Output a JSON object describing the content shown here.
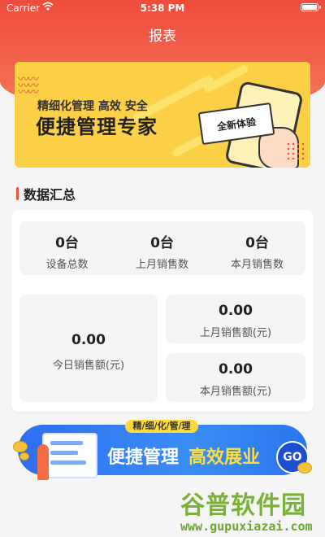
{
  "status_bar": {
    "carrier": "Carrier",
    "time": "5:38 PM",
    "wifi_icon": "wifi-icon",
    "battery_icon": "battery-icon"
  },
  "header": {
    "title": "报表"
  },
  "top_banner": {
    "subtitle": "精细化管理 高效 安全",
    "headline": "便捷管理专家",
    "card_text": "全新体验"
  },
  "section": {
    "title": "数据汇总"
  },
  "summary": {
    "top_stats": [
      {
        "value": "0台",
        "label": "设备总数"
      },
      {
        "value": "0台",
        "label": "上月销售数"
      },
      {
        "value": "0台",
        "label": "本月销售数"
      }
    ],
    "today_sales": {
      "value": "0.00",
      "label": "今日销售额(元)"
    },
    "last_month_sales": {
      "value": "0.00",
      "label": "上月销售额(元)"
    },
    "this_month_sales": {
      "value": "0.00",
      "label": "本月销售额(元)"
    }
  },
  "bottom_banner": {
    "tag": "精/细/化/管/理",
    "text_white": "便捷管理",
    "text_yellow": "高效展业",
    "go": "GO"
  },
  "watermark": {
    "main": "谷普软件园",
    "url": "www.gupuxiazai.com"
  },
  "colors": {
    "header_red": "#ef4c3c",
    "banner_yellow": "#fbd046",
    "accent_red": "#e8533b",
    "banner_blue": "#2d6ef0"
  }
}
